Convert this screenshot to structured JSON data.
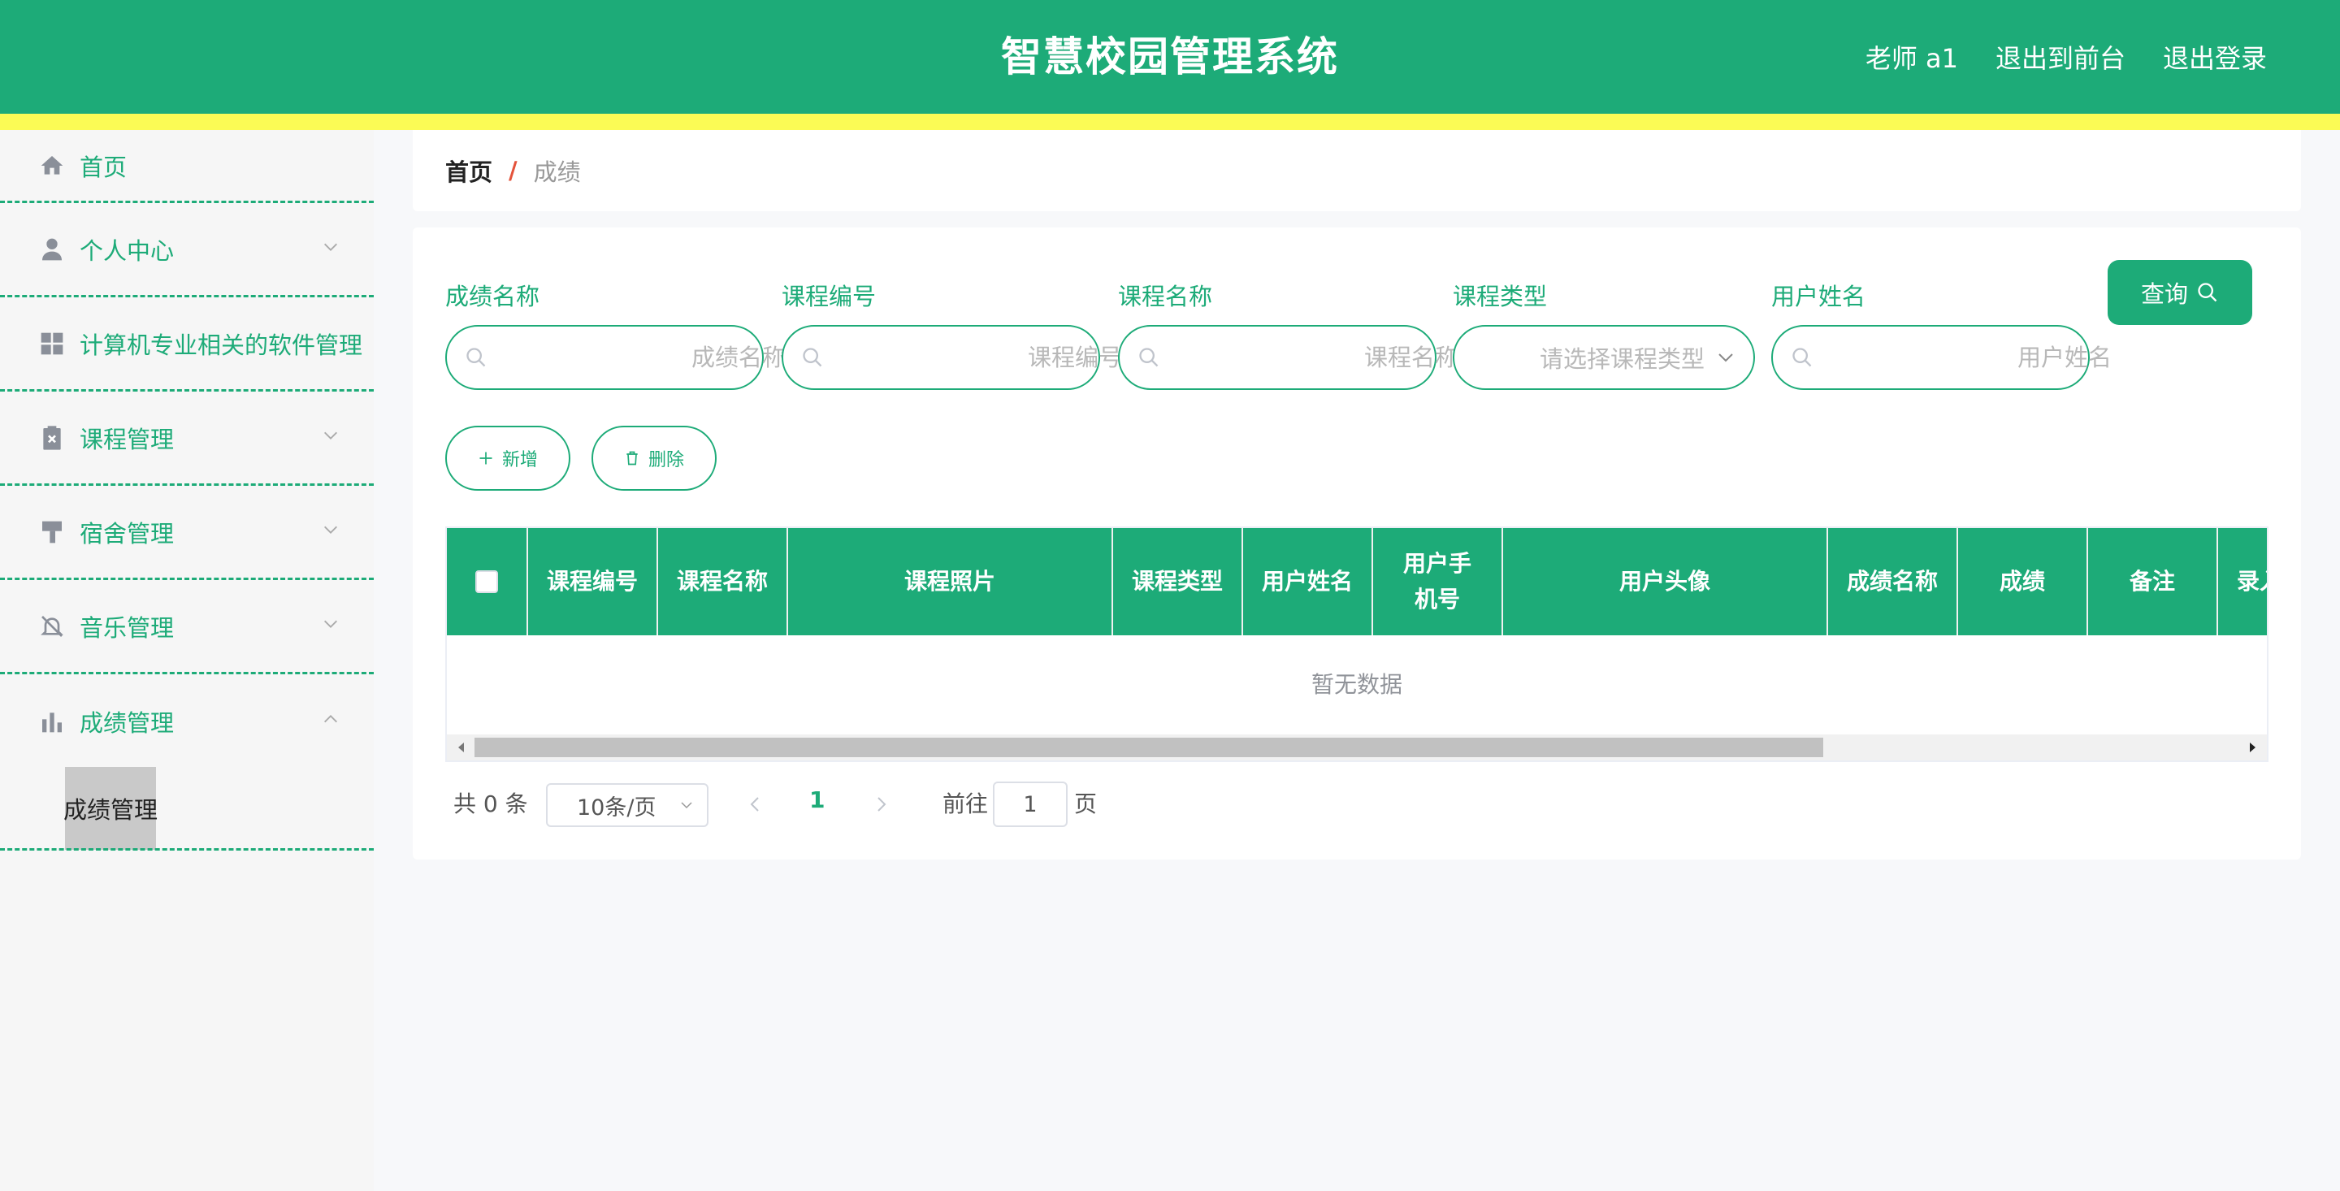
{
  "header": {
    "title": "智慧校园管理系统",
    "user": "老师 a1",
    "to_front": "退出到前台",
    "logout": "退出登录"
  },
  "sidebar": {
    "items": [
      {
        "label": "首页",
        "icon": "home-icon"
      },
      {
        "label": "个人中心",
        "icon": "user-icon",
        "expand": "down"
      },
      {
        "label": "计算机专业相关的软件管理",
        "icon": "grid-icon"
      },
      {
        "label": "课程管理",
        "icon": "clipboard-icon",
        "expand": "down"
      },
      {
        "label": "宿舍管理",
        "icon": "brush-icon",
        "expand": "down"
      },
      {
        "label": "音乐管理",
        "icon": "bell-off-icon",
        "expand": "down"
      },
      {
        "label": "成绩管理",
        "icon": "chart-icon",
        "expand": "up"
      }
    ],
    "active_sub": "成绩管理"
  },
  "breadcrumb": {
    "home": "首页",
    "separator": "/",
    "current": "成绩"
  },
  "search": {
    "fields": [
      {
        "label": "成绩名称",
        "placeholder": "成绩名称"
      },
      {
        "label": "课程编号",
        "placeholder": "课程编号"
      },
      {
        "label": "课程名称",
        "placeholder": "课程名称"
      },
      {
        "label": "课程类型",
        "placeholder": "请选择课程类型"
      },
      {
        "label": "用户姓名",
        "placeholder": "用户姓名"
      }
    ],
    "query_label": "查询"
  },
  "actions": {
    "add_label": "新增",
    "delete_label": "删除"
  },
  "table": {
    "columns": [
      "课程编号",
      "课程名称",
      "课程照片",
      "课程类型",
      "用户姓名",
      "用户手机号",
      "用户头像",
      "成绩名称",
      "成绩",
      "备注",
      "录入时间"
    ],
    "empty_text": "暂无数据"
  },
  "pagination": {
    "total": "共 0 条",
    "page_size": "10条/页",
    "current_page": "1",
    "goto_label": "前往",
    "goto_value": "1",
    "page_unit": "页"
  },
  "colors": {
    "primary": "#1dab78",
    "stripe": "#fbfb55"
  }
}
